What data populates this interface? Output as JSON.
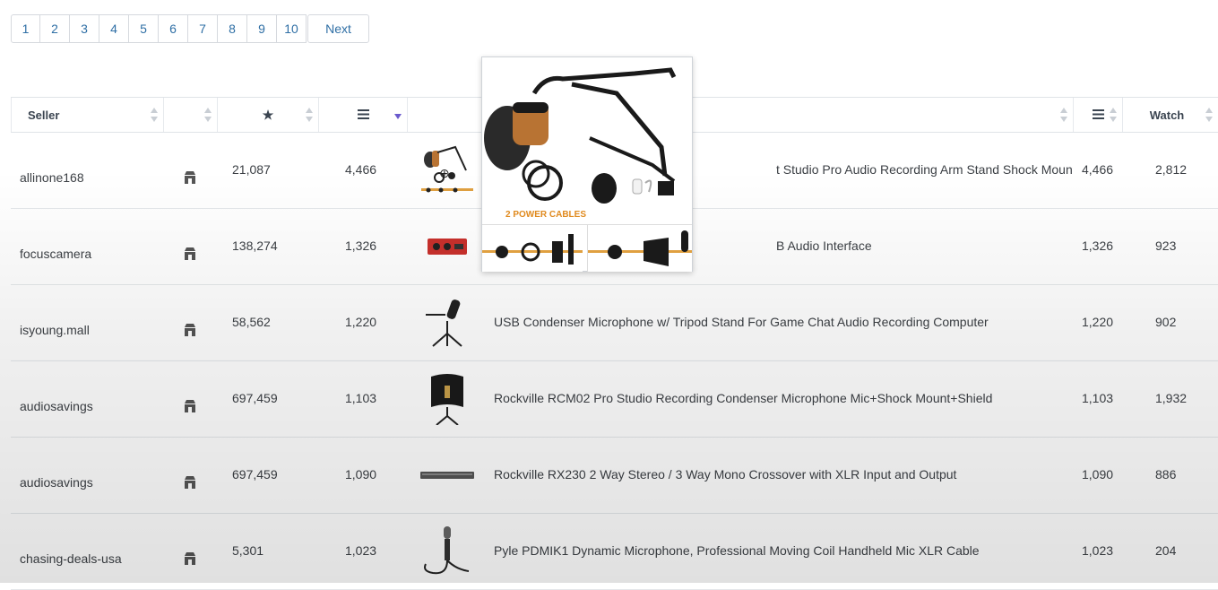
{
  "pagination": {
    "pages": [
      "1",
      "2",
      "3",
      "4",
      "5",
      "6",
      "7",
      "8",
      "9",
      "10"
    ],
    "next_label": "Next"
  },
  "table": {
    "headers": {
      "seller": "Seller",
      "watch": "Watch"
    },
    "rows": [
      {
        "seller": "allinone168",
        "feedback": "21,087",
        "count": "4,466",
        "title": "t Studio Pro Audio Recording Arm Stand Shock Mount",
        "sold": "4,466",
        "watch": "2,812"
      },
      {
        "seller": "focuscamera",
        "feedback": "138,274",
        "count": "1,326",
        "title": "B Audio Interface",
        "sold": "1,326",
        "watch": "923"
      },
      {
        "seller": "isyoung.mall",
        "feedback": "58,562",
        "count": "1,220",
        "title": "USB Condenser Microphone w/ Tripod Stand For Game Chat Audio Recording Computer",
        "sold": "1,220",
        "watch": "902"
      },
      {
        "seller": "audiosavings",
        "feedback": "697,459",
        "count": "1,103",
        "title": "Rockville RCM02 Pro Studio Recording Condenser Microphone Mic+Shock Mount+Shield",
        "sold": "1,103",
        "watch": "1,932"
      },
      {
        "seller": "audiosavings",
        "feedback": "697,459",
        "count": "1,090",
        "title": "Rockville RX230 2 Way Stereo / 3 Way Mono Crossover with XLR Input and Output",
        "sold": "1,090",
        "watch": "886"
      },
      {
        "seller": "chasing-deals-usa",
        "feedback": "5,301",
        "count": "1,023",
        "title": "Pyle PDMIK1 Dynamic Microphone, Professional Moving Coil Handheld Mic XLR Cable",
        "sold": "1,023",
        "watch": "204"
      }
    ]
  },
  "popup": {
    "caption": "2 POWER CABLES"
  },
  "icons": {
    "store": "store-icon",
    "star": "star-icon",
    "list": "list-icon",
    "zoom": "zoom-in-icon"
  },
  "colors": {
    "link": "#2f6fa5",
    "sort_active": "#6a5acd",
    "caption": "#e08a1e"
  }
}
